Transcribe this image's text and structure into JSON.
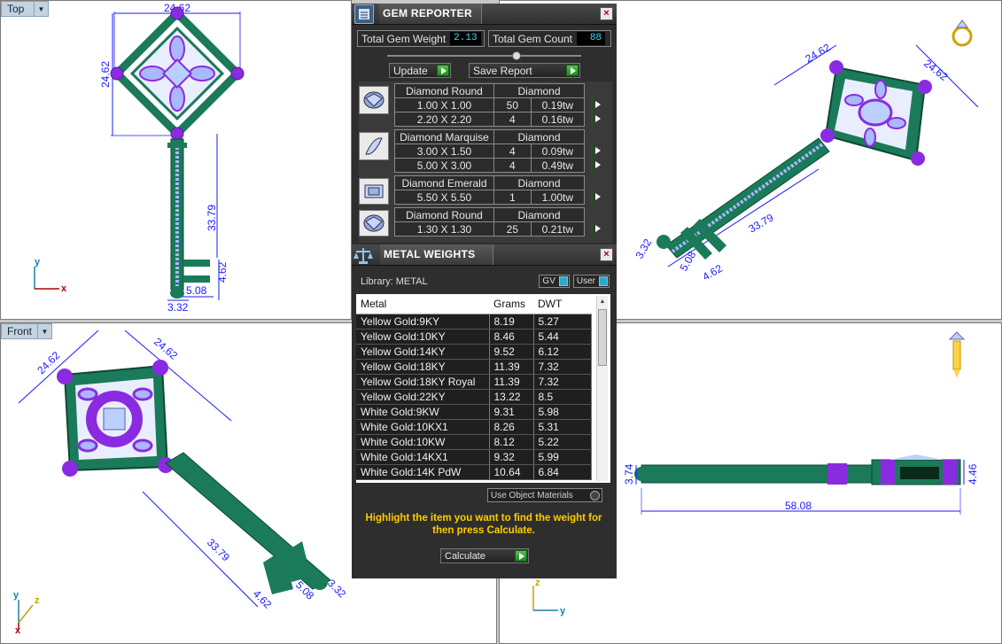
{
  "viewports": {
    "top": {
      "label": "Top",
      "dims": {
        "width": "24.62",
        "height": "24.62",
        "shaft": "33.79",
        "bit": "4.62",
        "bit2": "5.08",
        "ring": "3.32"
      }
    },
    "front": {
      "label": "Front",
      "dims": {
        "a": "24.62",
        "b": "24.62",
        "shaft": "33.79",
        "bit": "4.62",
        "bit2": "5.08",
        "ring": "3.32"
      }
    },
    "perspective": {
      "dims": {
        "a": "24.62",
        "b": "24.62",
        "shaft": "33.79",
        "bit": "4.62",
        "bit2": "5.08",
        "ring": "3.32"
      }
    },
    "right": {
      "dims": {
        "left": "3.74",
        "right": "4.46",
        "length": "58.08"
      }
    },
    "axes": {
      "x": "x",
      "y": "y",
      "z": "z"
    }
  },
  "gem_reporter": {
    "title": "GEM REPORTER",
    "close": "×",
    "total_weight_label": "Total Gem Weight",
    "total_weight": "2.13",
    "total_count_label": "Total Gem Count",
    "total_count": "88",
    "update_label": "Update",
    "save_label": "Save Report",
    "groups": [
      {
        "icon": "round-diamond-icon",
        "name": "Diamond Round",
        "type": "Diamond",
        "rows": [
          {
            "size": "1.00 X 1.00",
            "count": "50",
            "tw": "0.19tw"
          },
          {
            "size": "2.20 X 2.20",
            "count": "4",
            "tw": "0.16tw"
          }
        ]
      },
      {
        "icon": "marquise-diamond-icon",
        "name": "Diamond Marquise",
        "type": "Diamond",
        "rows": [
          {
            "size": "3.00 X 1.50",
            "count": "4",
            "tw": "0.09tw"
          },
          {
            "size": "5.00 X 3.00",
            "count": "4",
            "tw": "0.49tw"
          }
        ]
      },
      {
        "icon": "emerald-diamond-icon",
        "name": "Diamond Emerald",
        "type": "Diamond",
        "rows": [
          {
            "size": "5.50 X 5.50",
            "count": "1",
            "tw": "1.00tw"
          }
        ]
      },
      {
        "icon": "round-diamond-icon",
        "name": "Diamond Round",
        "type": "Diamond",
        "rows": [
          {
            "size": "1.30 X 1.30",
            "count": "25",
            "tw": "0.21tw"
          }
        ]
      }
    ]
  },
  "metal_weights": {
    "title": "METAL WEIGHTS",
    "close": "×",
    "library_label": "Library: METAL",
    "gv_label": "GV",
    "user_label": "User",
    "headers": {
      "metal": "Metal",
      "grams": "Grams",
      "dwt": "DWT"
    },
    "rows": [
      {
        "metal": "Yellow Gold:9KY",
        "grams": "8.19",
        "dwt": "5.27"
      },
      {
        "metal": "Yellow Gold:10KY",
        "grams": "8.46",
        "dwt": "5.44"
      },
      {
        "metal": "Yellow Gold:14KY",
        "grams": "9.52",
        "dwt": "6.12"
      },
      {
        "metal": "Yellow Gold:18KY",
        "grams": "11.39",
        "dwt": "7.32"
      },
      {
        "metal": "Yellow Gold:18KY Royal",
        "grams": "11.39",
        "dwt": "7.32"
      },
      {
        "metal": "Yellow Gold:22KY",
        "grams": "13.22",
        "dwt": "8.5"
      },
      {
        "metal": "White Gold:9KW",
        "grams": "9.31",
        "dwt": "5.98"
      },
      {
        "metal": "White Gold:10KX1",
        "grams": "8.26",
        "dwt": "5.31"
      },
      {
        "metal": "White Gold:10KW",
        "grams": "8.12",
        "dwt": "5.22"
      },
      {
        "metal": "White Gold:14KX1",
        "grams": "9.32",
        "dwt": "5.99"
      },
      {
        "metal": "White Gold:14K PdW",
        "grams": "10.64",
        "dwt": "6.84"
      }
    ],
    "use_object_label": "Use Object Materials",
    "hint": "Highlight the item you want to find the weight for then press Calculate.",
    "calculate_label": "Calculate"
  },
  "colors": {
    "metal": "#1a7a5a",
    "prong": "#8a2be2",
    "gem": "#a9b8ff",
    "dim": "#1a1aff",
    "accent": "#34e0ff"
  }
}
